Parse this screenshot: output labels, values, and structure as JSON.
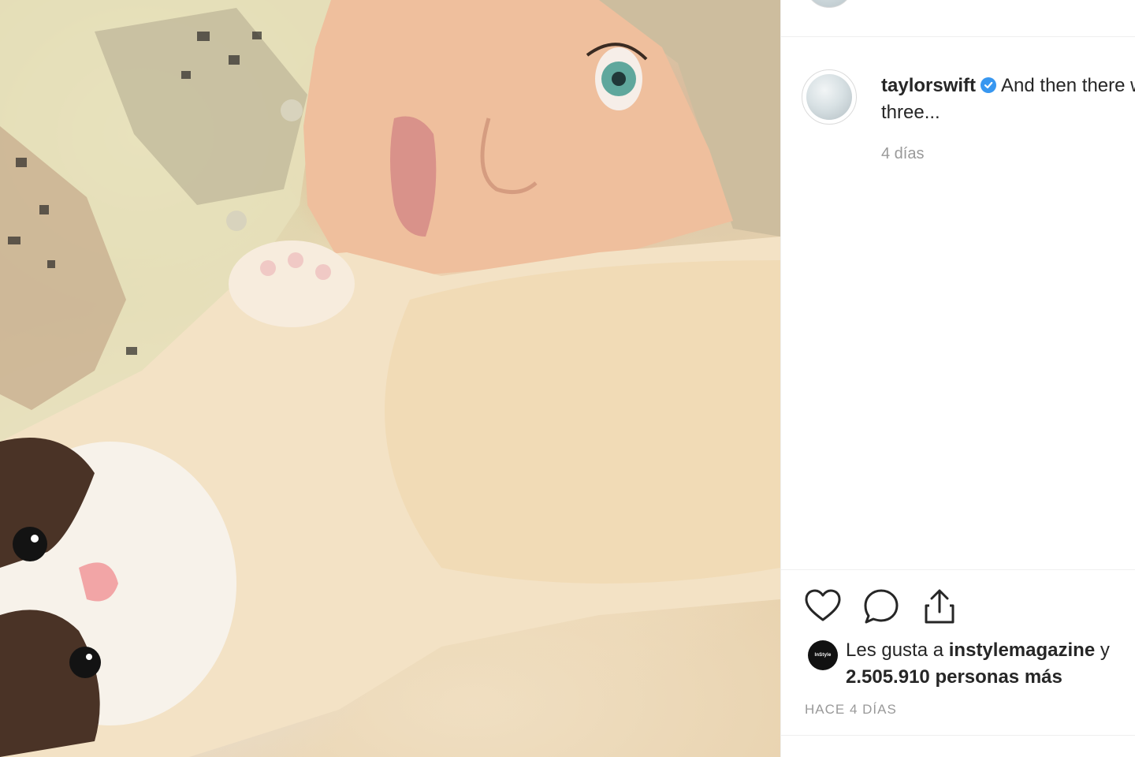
{
  "post": {
    "username": "taylorswift",
    "caption_text": "And then there were three...",
    "caption_relative_time": "4 días",
    "likes": {
      "prefix": "Les gusta a",
      "liked_by_user": "instylemagazine",
      "conjunction": "y",
      "count_text": "2.505.910 personas más",
      "avatar_label": "InStyle"
    },
    "timestamp": "HACE 4 DÍAS"
  },
  "icons": {
    "like": "heart-outline-icon",
    "comment": "speech-bubble-icon",
    "share": "share-upload-icon",
    "verified": "verified-badge-icon"
  },
  "colors": {
    "verified_blue": "#3897f0",
    "text": "#262626",
    "muted": "#999999",
    "divider": "#efefef"
  }
}
